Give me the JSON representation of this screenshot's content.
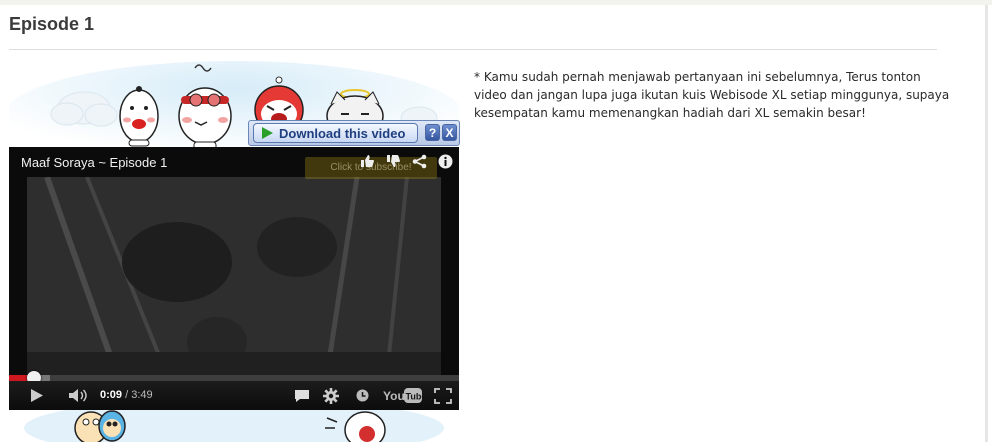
{
  "page": {
    "title": "Episode 1"
  },
  "download_bar": {
    "label": "Download this video",
    "help": "?",
    "close": "X"
  },
  "player": {
    "video_title": "Maaf Soraya ~ Episode 1",
    "overlay_text": "Click to subscribe!",
    "current_time": "0:09",
    "duration": " / 3:49",
    "progress_fraction": 0.039,
    "loaded_fraction": 0.09,
    "brand": "YouTube"
  },
  "description": "* Kamu sudah pernah menjawab pertanyaan ini sebelumnya, Terus tonton video dan jangan lupa juga ikutan kuis Webisode XL setiap minggunya, supaya kesempatan kamu memenangkan hadiah dari XL semakin besar!"
}
